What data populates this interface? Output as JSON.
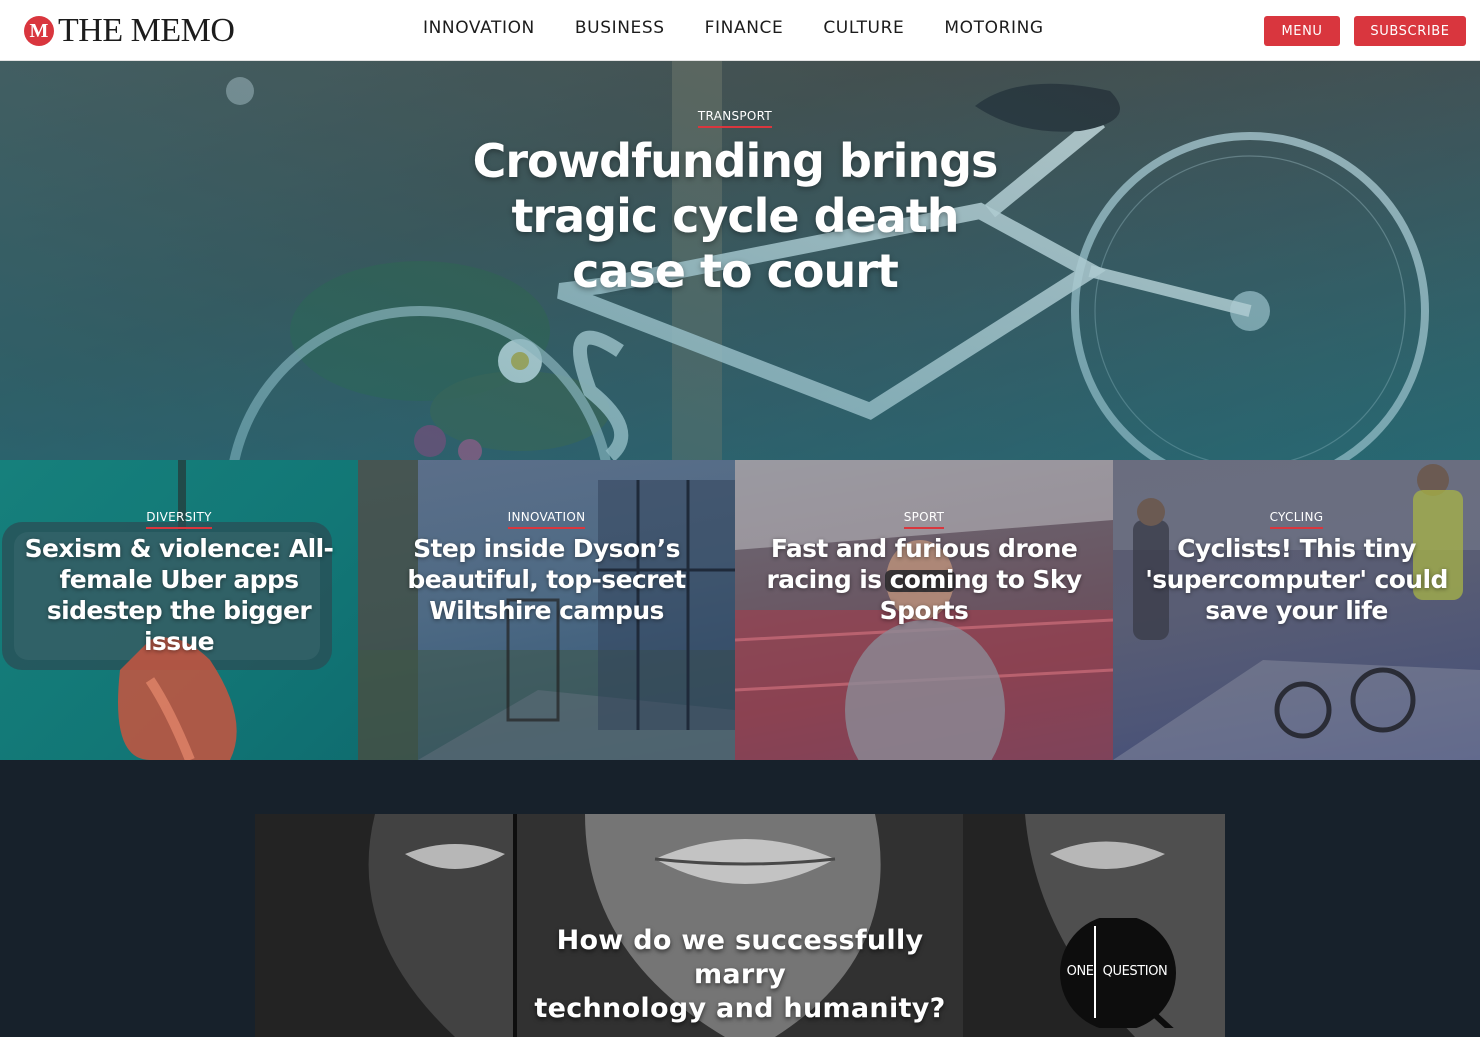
{
  "header": {
    "logo_letter": "M",
    "logo_text": "THE MEMO",
    "nav": [
      "INNOVATION",
      "BUSINESS",
      "FINANCE",
      "CULTURE",
      "MOTORING"
    ],
    "menu_label": "MENU",
    "subscribe_label": "SUBSCRIBE"
  },
  "hero": {
    "kicker": "TRANSPORT",
    "title_lines": [
      "Crowdfunding brings",
      "tragic cycle death",
      "case to court"
    ]
  },
  "cards": [
    {
      "kicker": "DIVERSITY",
      "title": "Sexism & violence: All-female Uber apps sidestep the bigger issue"
    },
    {
      "kicker": "INNOVATION",
      "title": "Step inside Dyson’s beautiful, top-secret Wiltshire campus"
    },
    {
      "kicker": "SPORT",
      "title": "Fast and furious drone racing is coming to Sky Sports"
    },
    {
      "kicker": "CYCLING",
      "title": "Cyclists! This tiny 'supercomputer' could save your life"
    }
  ],
  "banner": {
    "question_lines": [
      "How do we successfully marry",
      "technology and humanity?"
    ],
    "badge_left": "ONE",
    "badge_right": "QUESTION"
  },
  "colors": {
    "accent": "#d9363e",
    "page_bg": "#17212b",
    "header_bg": "#ffffff"
  },
  "icons": {
    "logo": "memo-m-badge-icon",
    "one_question": "magnifier-icon"
  }
}
